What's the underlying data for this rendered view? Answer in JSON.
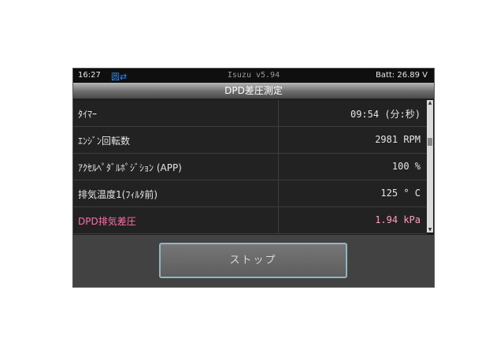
{
  "status": {
    "time": "16:27",
    "connection": "圆⇄",
    "app_version": "Isuzu v5.94",
    "battery": "Batt: 26.89 V"
  },
  "screen_title": "DPD差圧測定",
  "rows": [
    {
      "label": "ﾀｲﾏｰ",
      "value": "09:54 (分:秒)"
    },
    {
      "label": "ｴﾝｼﾞﾝ回転数",
      "value": "2981 RPM"
    },
    {
      "label": "ｱｸｾﾙﾍﾟﾀﾞﾙﾎﾟｼﾞｼｮﾝ (APP)",
      "value": "100 %"
    },
    {
      "label": "排気温度1(ﾌｨﾙﾀ前)",
      "value": "125 ° C"
    },
    {
      "label": "DPD排気差圧",
      "value": "1.94 kPa"
    }
  ],
  "stop_button": "ストップ",
  "colors": {
    "highlight_text": "#ff6fa8",
    "connection_icon": "#2f8cff",
    "button_border": "#8fb6c8"
  }
}
